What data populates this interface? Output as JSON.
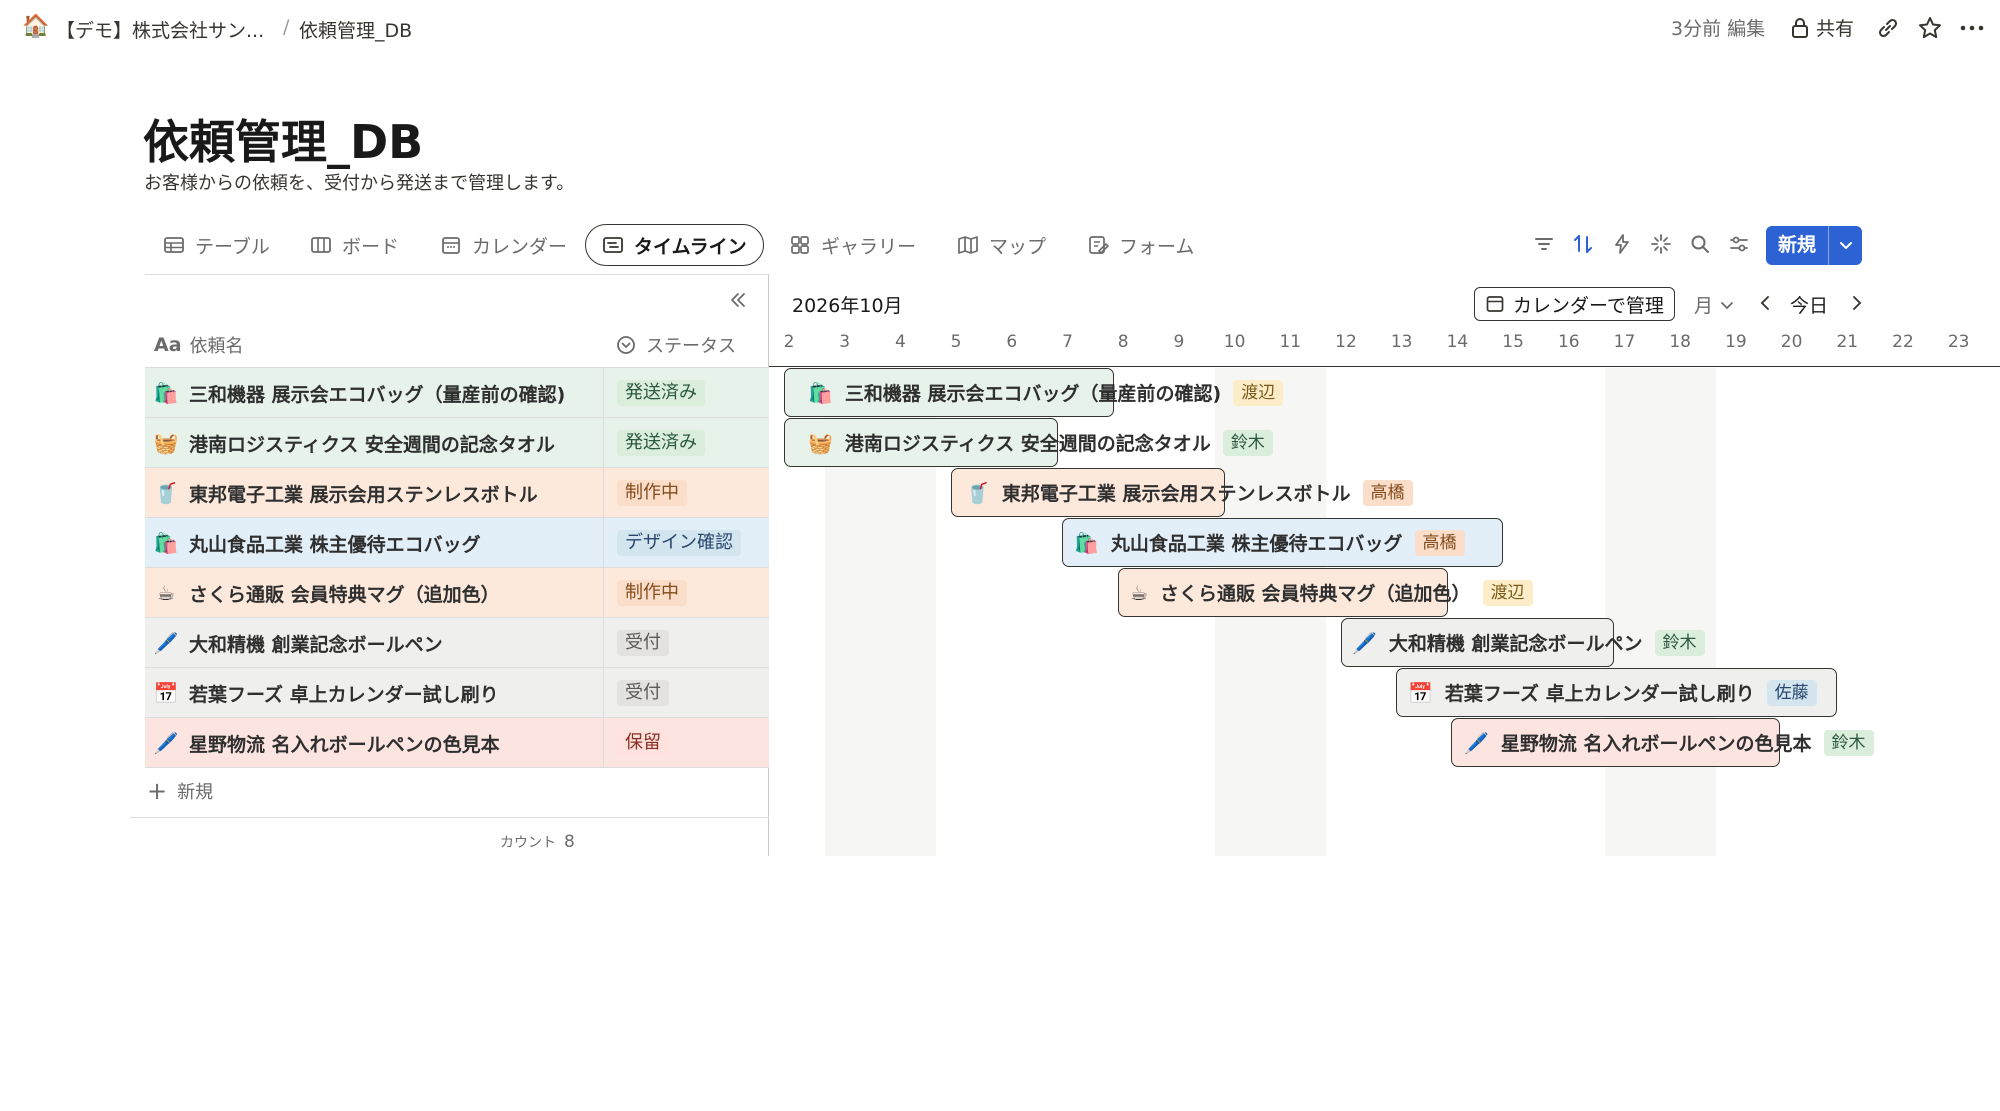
{
  "breadcrumb": {
    "workspace": "【デモ】株式会社サン...",
    "separator": "/",
    "page": "依頼管理_DB"
  },
  "topbar": {
    "edited": "3分前 編集",
    "share": "共有"
  },
  "page": {
    "title": "依頼管理_DB",
    "description": "お客様からの依頼を、受付から発送まで管理します。"
  },
  "views": [
    {
      "label": "テーブル",
      "icon": "table-icon"
    },
    {
      "label": "ボード",
      "icon": "board-icon"
    },
    {
      "label": "カレンダー",
      "icon": "calendar-icon"
    },
    {
      "label": "タイムライン",
      "icon": "timeline-icon",
      "active": true
    },
    {
      "label": "ギャラリー",
      "icon": "gallery-icon"
    },
    {
      "label": "マップ",
      "icon": "map-icon"
    },
    {
      "label": "フォーム",
      "icon": "form-icon"
    }
  ],
  "toolbar": {
    "new_label": "新規"
  },
  "table": {
    "columns": {
      "name": "依頼名",
      "name_prefix": "Aa",
      "status": "ステータス"
    },
    "rows": [
      {
        "icon": "🛍️",
        "name": "三和機器 展示会エコバッグ（量産前の確認)",
        "status": "発送済み"
      },
      {
        "icon": "🧺",
        "name": "港南ロジスティクス 安全週間の記念タオル",
        "status": "発送済み"
      },
      {
        "icon": "🥤",
        "name": "東邦電子工業 展示会用ステンレスボトル",
        "status": "制作中"
      },
      {
        "icon": "🛍️",
        "name": "丸山食品工業 株主優待エコバッグ",
        "status": "デザイン確認"
      },
      {
        "icon": "☕",
        "name": "さくら通販 会員特典マグ（追加色）",
        "status": "制作中"
      },
      {
        "icon": "🖊️",
        "name": "大和精機 創業記念ボールペン",
        "status": "受付"
      },
      {
        "icon": "📅",
        "name": "若葉フーズ 卓上カレンダー試し刷り",
        "status": "受付"
      },
      {
        "icon": "🖊️",
        "name": "星野物流 名入れボールペンの色見本",
        "status": "保留"
      }
    ],
    "add_new": "新規",
    "count_label": "カウント",
    "count": "8"
  },
  "timeline": {
    "month": "2026年10月",
    "manage_calendar": "カレンダーで管理",
    "scale": "月",
    "today": "今日",
    "days": [
      "2",
      "3",
      "4",
      "5",
      "6",
      "7",
      "8",
      "9",
      "10",
      "11",
      "12",
      "13",
      "14",
      "15",
      "16",
      "17",
      "18",
      "19",
      "20",
      "21",
      "22",
      "23"
    ],
    "bars": [
      {
        "icon": "🛍️",
        "name": "三和機器 展示会エコバッグ（量産前の確認)",
        "assignee": "渡辺"
      },
      {
        "icon": "🧺",
        "name": "港南ロジスティクス 安全週間の記念タオル",
        "assignee": "鈴木"
      },
      {
        "icon": "🥤",
        "name": "東邦電子工業 展示会用ステンレスボトル",
        "assignee": "高橋"
      },
      {
        "icon": "🛍️",
        "name": "丸山食品工業 株主優待エコバッグ",
        "assignee": "高橋"
      },
      {
        "icon": "☕",
        "name": "さくら通販 会員特典マグ（追加色）",
        "assignee": "渡辺"
      },
      {
        "icon": "🖊️",
        "name": "大和精機 創業記念ボールペン",
        "assignee": "鈴木"
      },
      {
        "icon": "📅",
        "name": "若葉フーズ 卓上カレンダー試し刷り",
        "assignee": "佐藤"
      },
      {
        "icon": "🖊️",
        "name": "星野物流 名入れボールペンの色見本",
        "assignee": "鈴木"
      }
    ]
  },
  "colors": {
    "status_shipped_bg": "#dbeddb",
    "status_shipped_fg": "#2b593f",
    "status_production_bg": "#fadec9",
    "status_production_fg": "#854c1d",
    "status_design_bg": "#d3e5ef",
    "status_design_fg": "#28456c",
    "status_received_bg": "#e3e2e0",
    "status_received_fg": "#5a5a5a",
    "status_hold_bg": "#ffe2dd",
    "status_hold_fg": "#8a2f24",
    "primary": "#2c62d4"
  }
}
